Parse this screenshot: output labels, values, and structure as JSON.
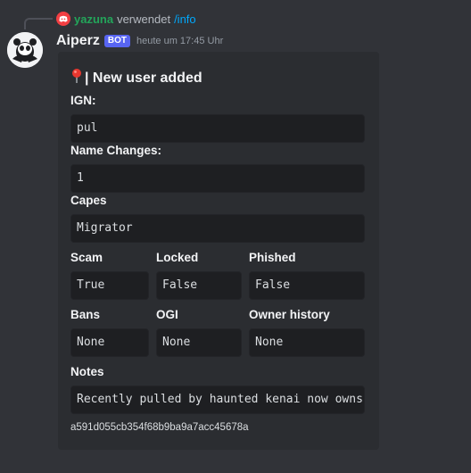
{
  "reply": {
    "user": "yazuna",
    "text": "verwendet",
    "command": "/info"
  },
  "message": {
    "username": "Aiperz",
    "bot_tag": "BOT",
    "timestamp": "heute um 17:45 Uhr"
  },
  "embed": {
    "title": "| New user added",
    "fields": {
      "ign": {
        "name": "IGN:",
        "value": "pul"
      },
      "name_changes": {
        "name": "Name Changes:",
        "value": "1"
      },
      "capes": {
        "name": "Capes",
        "value": "Migrator"
      },
      "scam": {
        "name": "Scam",
        "value": "True"
      },
      "locked": {
        "name": "Locked",
        "value": "False"
      },
      "phished": {
        "name": "Phished",
        "value": "False"
      },
      "bans": {
        "name": "Bans",
        "value": "None"
      },
      "ogi": {
        "name": "OGI",
        "value": "None"
      },
      "owner_history": {
        "name": "Owner history",
        "value": "None"
      },
      "notes": {
        "name": "Notes",
        "value": "Recently pulled by haunted kenai now owns"
      }
    },
    "footer": "a591d055cb354f68b9ba9a7acc45678a"
  },
  "colors": {
    "background": "#313338",
    "embed_bg": "#2b2d31",
    "code_bg": "#1e1f22",
    "bot_tag": "#5865f2",
    "reply_user": "#23a55a",
    "command": "#00a8fc"
  }
}
